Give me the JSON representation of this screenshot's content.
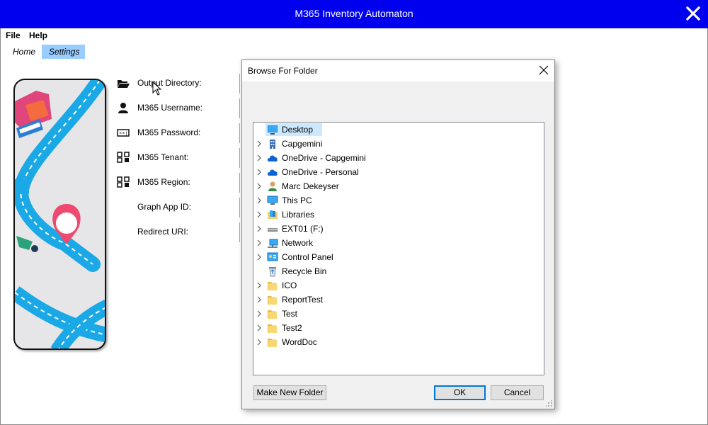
{
  "window": {
    "title": "M365 Inventory Automaton",
    "accent_color": "#0000ee",
    "close_icon": "close-icon"
  },
  "menu": {
    "file": "File",
    "help": "Help"
  },
  "tabs": [
    {
      "label": "Home",
      "active": false
    },
    {
      "label": "Settings",
      "active": true
    }
  ],
  "settings": {
    "fields": [
      {
        "label": "Output Directory:",
        "icon": "folder-open-icon"
      },
      {
        "label": "M365 Username:",
        "icon": "user-icon"
      },
      {
        "label": "M365 Password:",
        "icon": "password-icon"
      },
      {
        "label": "M365 Tenant:",
        "icon": "tenant-icon"
      },
      {
        "label": "M365 Region:",
        "icon": "region-icon"
      },
      {
        "label": "Graph App ID:",
        "icon": ""
      },
      {
        "label": "Redirect URI:",
        "icon": ""
      }
    ]
  },
  "dialog": {
    "title": "Browse For Folder",
    "tree": [
      {
        "label": "Desktop",
        "icon": "desktop-icon",
        "expandable": false,
        "selected": true
      },
      {
        "label": "Capgemini",
        "icon": "building-icon",
        "expandable": true
      },
      {
        "label": "OneDrive - Capgemini",
        "icon": "cloud-icon",
        "expandable": true
      },
      {
        "label": "OneDrive - Personal",
        "icon": "cloud-icon",
        "expandable": true
      },
      {
        "label": "Marc Dekeyser",
        "icon": "user-folder-icon",
        "expandable": true
      },
      {
        "label": "This PC",
        "icon": "computer-icon",
        "expandable": true
      },
      {
        "label": "Libraries",
        "icon": "libraries-icon",
        "expandable": true
      },
      {
        "label": "EXT01 (F:)",
        "icon": "drive-icon",
        "expandable": true
      },
      {
        "label": "Network",
        "icon": "network-icon",
        "expandable": true
      },
      {
        "label": "Control Panel",
        "icon": "control-panel-icon",
        "expandable": true
      },
      {
        "label": "Recycle Bin",
        "icon": "recycle-bin-icon",
        "expandable": false
      },
      {
        "label": "ICO",
        "icon": "folder-icon",
        "expandable": true
      },
      {
        "label": "ReportTest",
        "icon": "folder-icon",
        "expandable": true
      },
      {
        "label": "Test",
        "icon": "folder-icon",
        "expandable": true
      },
      {
        "label": "Test2",
        "icon": "folder-icon",
        "expandable": true
      },
      {
        "label": "WordDoc",
        "icon": "folder-icon",
        "expandable": true
      }
    ],
    "buttons": {
      "new_folder": "Make New Folder",
      "ok": "OK",
      "cancel": "Cancel"
    }
  }
}
